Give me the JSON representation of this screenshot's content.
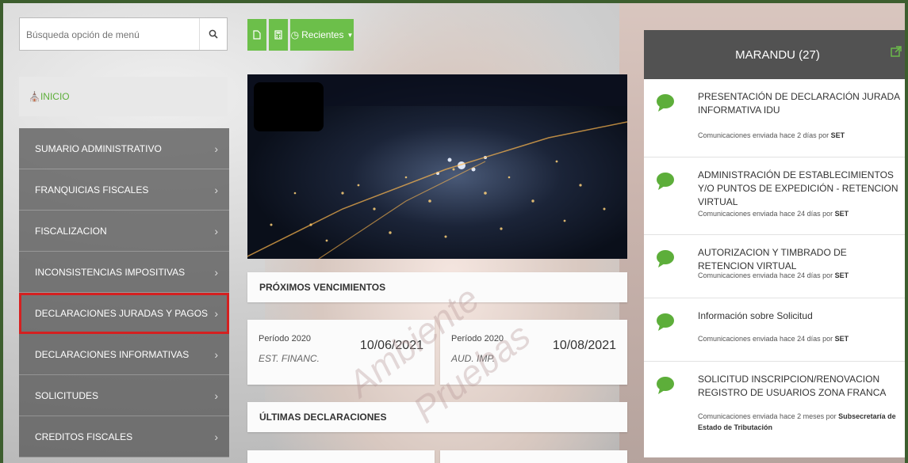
{
  "sidebar": {
    "search_placeholder": "Búsqueda opción de menú",
    "inicio_label": "INICIO",
    "items": [
      {
        "label": "SUMARIO ADMINISTRATIVO"
      },
      {
        "label": "FRANQUICIAS FISCALES"
      },
      {
        "label": "FISCALIZACION"
      },
      {
        "label": "INCONSISTENCIAS IMPOSITIVAS"
      },
      {
        "label": "DECLARACIONES JURADAS Y PAGOS"
      },
      {
        "label": "DECLARACIONES INFORMATIVAS"
      },
      {
        "label": "SOLICITUDES"
      },
      {
        "label": "CREDITOS FISCALES"
      }
    ],
    "chevron": "›"
  },
  "toolbar": {
    "recientes_label": "Recientes"
  },
  "vencimientos": {
    "title": "PRÓXIMOS VENCIMIENTOS",
    "items": [
      {
        "period": "Período 2020",
        "date": "10/06/2021",
        "desc": "EST. FINANC."
      },
      {
        "period": "Período 2020",
        "date": "10/08/2021",
        "desc": "AUD. IMP."
      }
    ]
  },
  "ultimas": {
    "title": "ÚLTIMAS DECLARACIONES"
  },
  "watermark": [
    "Ambiente",
    "Pruebas"
  ],
  "panel": {
    "title": "MARANDU (27)",
    "notifications": [
      {
        "title": "PRESENTACIÓN DE DECLARACIÓN JURADA INFORMATIVA IDU",
        "meta": "Comunicaciones enviada hace 2 días por",
        "by": "SET"
      },
      {
        "title": "ADMINISTRACIÓN DE ESTABLECIMIENTOS Y/O PUNTOS DE EXPEDICIÓN - RETENCION VIRTUAL",
        "meta": "Comunicaciones enviada hace 24 días por",
        "by": "SET"
      },
      {
        "title": "AUTORIZACION Y TIMBRADO DE RETENCION VIRTUAL",
        "meta": "Comunicaciones enviada hace 24 días por",
        "by": "SET"
      },
      {
        "title": "Información sobre Solicitud",
        "meta": "Comunicaciones enviada hace 24 días por",
        "by": "SET"
      },
      {
        "title": "SOLICITUD INSCRIPCION/RENOVACION REGISTRO DE USUARIOS ZONA FRANCA",
        "meta": "Comunicaciones enviada hace 2 meses por",
        "by": "Subsecretaría de Estado de Tributación"
      }
    ]
  },
  "colors": {
    "accent": "#6cbf4a",
    "highlight": "#d42020",
    "panel_header": "#525252"
  }
}
